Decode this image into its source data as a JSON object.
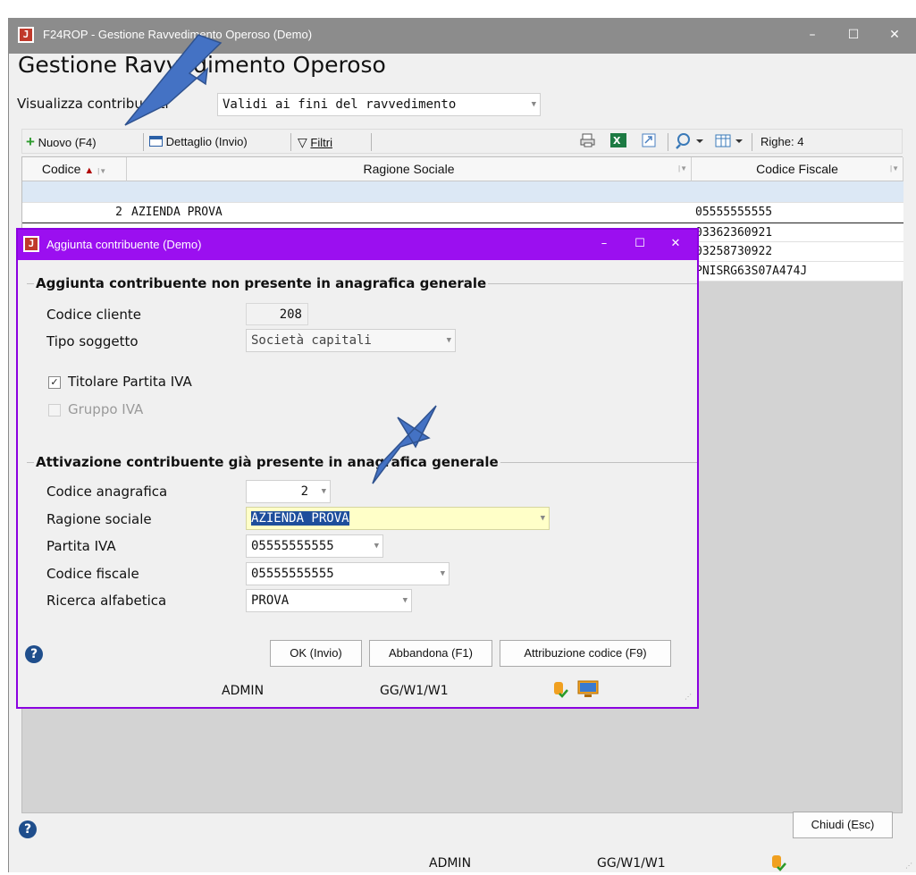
{
  "main_window": {
    "title": "F24ROP - Gestione Ravvedimento Operoso  (Demo)",
    "controls": {
      "minimize": "–",
      "maximize": "☐",
      "close": "✕"
    },
    "heading": "Gestione Ravvedimento Operoso",
    "filter": {
      "label": "Visualizza contribuenti",
      "value": "Validi ai fini del ravvedimento"
    },
    "toolbar": {
      "new_label": "Nuovo (F4)",
      "detail_label": "Dettaglio (Invio)",
      "filters_label": "Filtri",
      "rows_label": "Righe: 4"
    },
    "grid": {
      "columns": [
        "Codice",
        "Ragione Sociale",
        "Codice Fiscale"
      ],
      "rows": [
        {
          "codice": "2",
          "ragione": "AZIENDA PROVA",
          "cf": "05555555555"
        },
        {
          "codice": "",
          "ragione": "",
          "cf": "03362360921"
        },
        {
          "codice": "",
          "ragione": "",
          "cf": "03258730922"
        },
        {
          "codice": "",
          "ragione": "",
          "cf": "PNISRG63S07A474J"
        }
      ]
    },
    "close_button": "Chiudi (Esc)",
    "status": {
      "user": "ADMIN",
      "path": "GG/W1/W1"
    }
  },
  "dialog": {
    "title": "Aggiunta contribuente  (Demo)",
    "controls": {
      "minimize": "–",
      "maximize": "☐",
      "close": "✕"
    },
    "section1": {
      "title": "Aggiunta contribuente non presente in anagrafica generale",
      "codice_cliente": {
        "label": "Codice cliente",
        "value": "208"
      },
      "tipo_soggetto": {
        "label": "Tipo soggetto",
        "value": "Società capitali"
      },
      "titolare_iva": {
        "label": "Titolare Partita IVA",
        "checked": true
      },
      "gruppo_iva": {
        "label": "Gruppo IVA",
        "checked": false
      }
    },
    "section2": {
      "title": "Attivazione contribuente già presente in anagrafica generale",
      "codice_anagrafica": {
        "label": "Codice anagrafica",
        "value": "2"
      },
      "ragione_sociale": {
        "label": "Ragione sociale",
        "value": "AZIENDA PROVA"
      },
      "partita_iva": {
        "label": "Partita IVA",
        "value": "05555555555"
      },
      "codice_fiscale": {
        "label": "Codice fiscale",
        "value": "05555555555"
      },
      "ricerca_alfabetica": {
        "label": "Ricerca alfabetica",
        "value": "PROVA"
      }
    },
    "buttons": {
      "ok": "OK (Invio)",
      "abbandona": "Abbandona (F1)",
      "attribuzione": "Attribuzione codice (F9)"
    },
    "status": {
      "user": "ADMIN",
      "path": "GG/W1/W1"
    }
  },
  "colors": {
    "dialog_accent": "#9b0ff0",
    "main_titlebar": "#8c8c8c",
    "highlight_field": "#ffffc8",
    "selection": "#1e4e9c",
    "annotation_arrow": "#4472c4"
  }
}
